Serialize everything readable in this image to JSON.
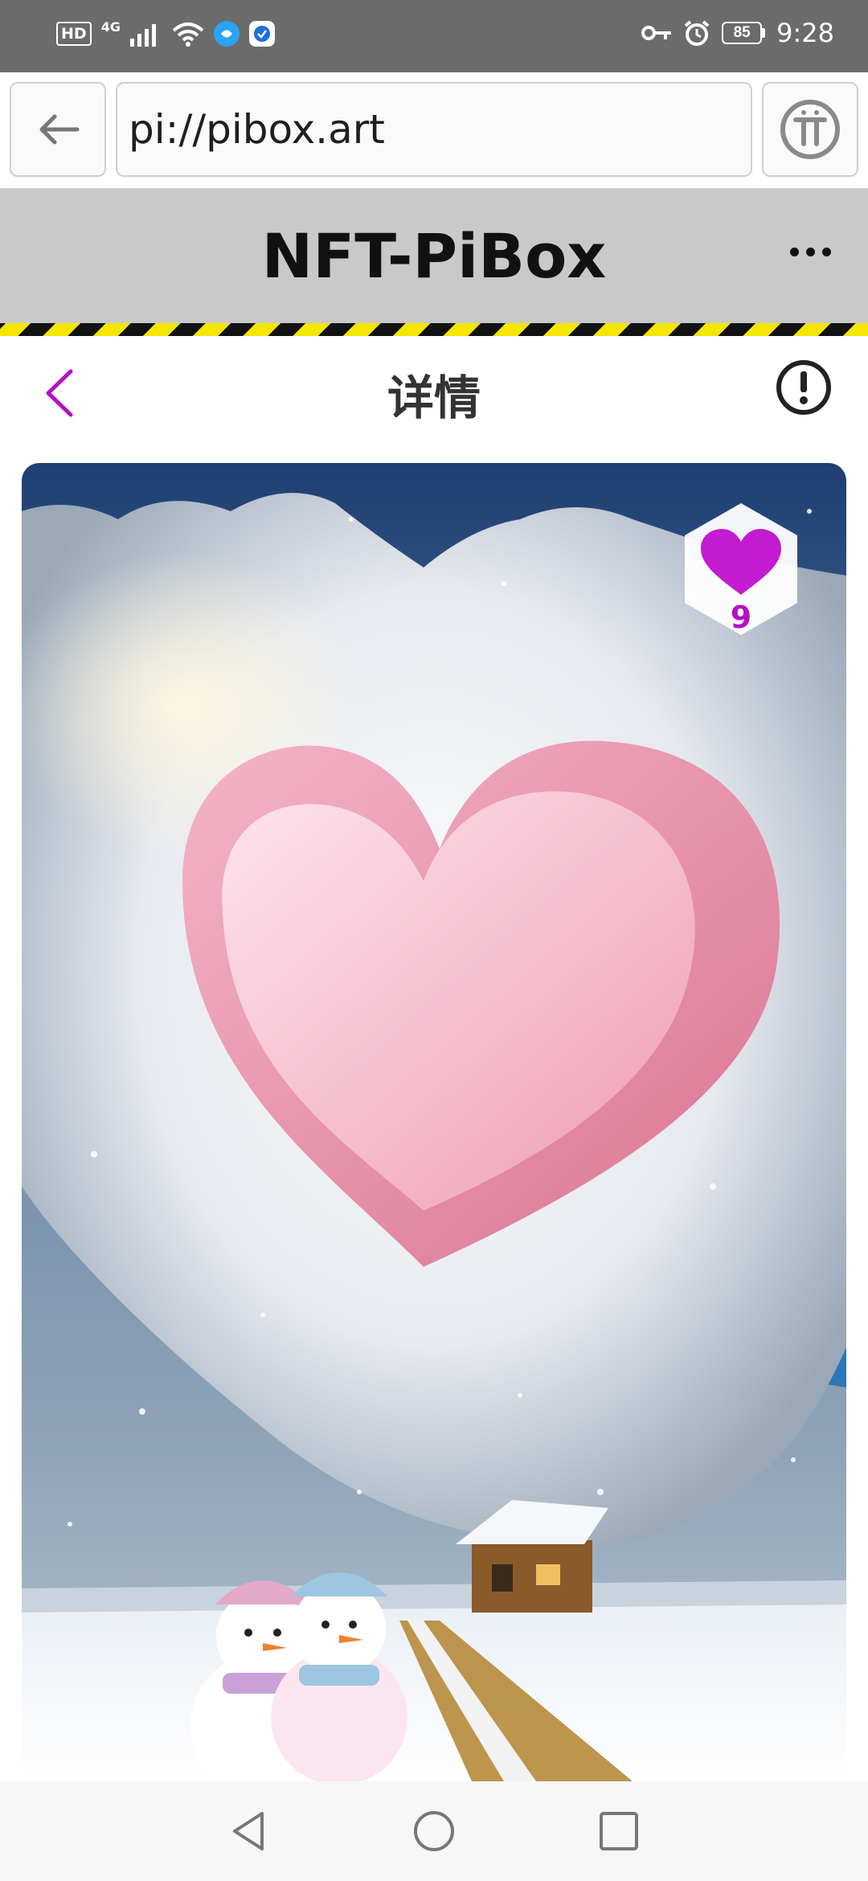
{
  "status_bar": {
    "hd_label": "HD",
    "network_label": "4G",
    "battery_level": "85",
    "time": "9:28"
  },
  "browser": {
    "url": "pi://pibox.art"
  },
  "site": {
    "title": "NFT-PiBox"
  },
  "detail": {
    "title": "详情",
    "likes": "9"
  },
  "colors": {
    "accent": "#b410c8",
    "header_bg": "#c9c9c9",
    "hazard_yellow": "#f4e600"
  },
  "icons": {
    "back": "arrow-left-icon",
    "pi": "pi-logo-icon",
    "more": "more-dots-icon",
    "nav_back": "chevron-left-icon",
    "info": "info-icon",
    "like": "heart-icon"
  }
}
